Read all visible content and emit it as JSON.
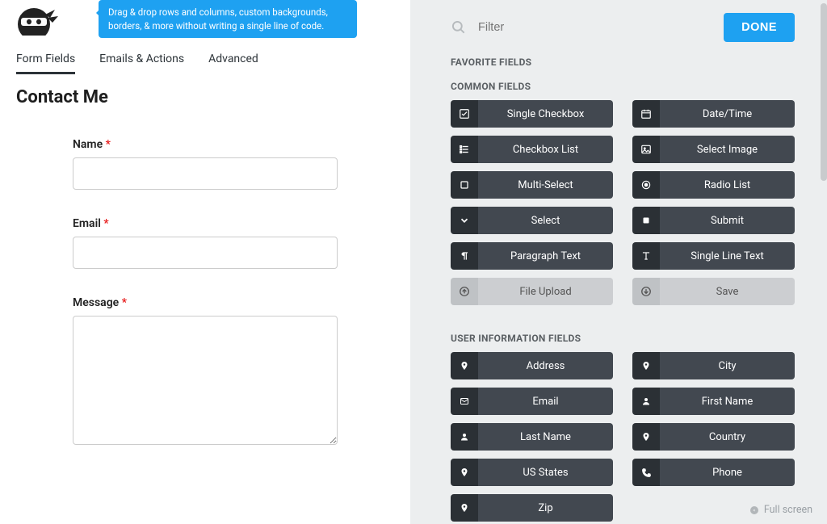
{
  "tip": "Drag & drop rows and columns, custom backgrounds, borders, & more without writing a single line of code.",
  "tabs": {
    "form_fields": "Form Fields",
    "emails_actions": "Emails & Actions",
    "advanced": "Advanced"
  },
  "form": {
    "title": "Contact Me",
    "fields": {
      "name": {
        "label": "Name",
        "required": "*"
      },
      "email": {
        "label": "Email",
        "required": "*"
      },
      "message": {
        "label": "Message",
        "required": "*"
      }
    }
  },
  "filter_placeholder": "Filter",
  "done": "DONE",
  "sections": {
    "favorite": "FAVORITE FIELDS",
    "common": "COMMON FIELDS",
    "user": "USER INFORMATION FIELDS"
  },
  "common_fields": {
    "single_checkbox": "Single Checkbox",
    "checkbox_list": "Checkbox List",
    "multi_select": "Multi-Select",
    "select": "Select",
    "paragraph": "Paragraph Text",
    "file_upload": "File Upload",
    "date_time": "Date/Time",
    "select_image": "Select Image",
    "radio_list": "Radio List",
    "submit": "Submit",
    "single_line": "Single Line Text",
    "save": "Save"
  },
  "user_fields": {
    "address": "Address",
    "email": "Email",
    "last_name": "Last Name",
    "us_states": "US States",
    "zip": "Zip",
    "city": "City",
    "first_name": "First Name",
    "country": "Country",
    "phone": "Phone"
  },
  "fullscreen": "Full screen"
}
